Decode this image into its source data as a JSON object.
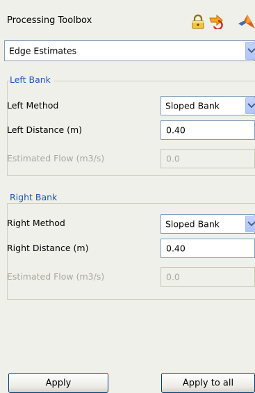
{
  "header": {
    "title": "Processing Toolbox",
    "icons": [
      "lock-icon",
      "arrow-icon",
      "matlab-icon"
    ]
  },
  "mode_select": {
    "value": "Edge Estimates"
  },
  "left_bank": {
    "group_title": "Left Bank",
    "method_label": "Left Method",
    "method_value": "Sloped Bank",
    "distance_label": "Left Distance (m)",
    "distance_value": "0.40",
    "flow_label": "Estimated Flow (m3/s)",
    "flow_value": "0.0"
  },
  "right_bank": {
    "group_title": "Right Bank",
    "method_label": "Right Method",
    "method_value": "Sloped Bank",
    "distance_label": "Right Distance (m)",
    "distance_value": "0.40",
    "flow_label": "Estimated Flow (m3/s)",
    "flow_value": "0.0"
  },
  "footer": {
    "apply_label": "Apply",
    "apply_all_label": "Apply to all"
  },
  "colors": {
    "background": "#f0f0ea",
    "group_title": "#1c54b7",
    "disabled_text": "#a8a8a0",
    "border": "#7f9db9"
  }
}
